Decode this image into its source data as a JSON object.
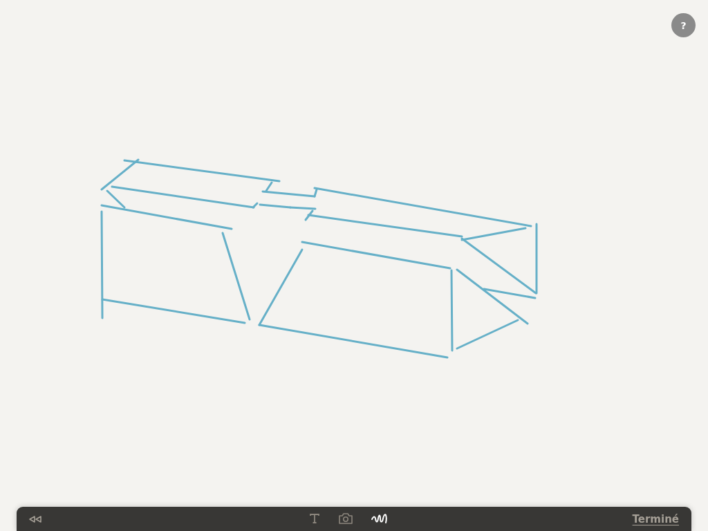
{
  "help_button": {
    "label": "?"
  },
  "toolbar": {
    "tools": [
      {
        "kind": "text",
        "selected": false
      },
      {
        "kind": "camera",
        "selected": false
      },
      {
        "kind": "draw",
        "selected": true
      }
    ],
    "done_link": "Terminé"
  }
}
